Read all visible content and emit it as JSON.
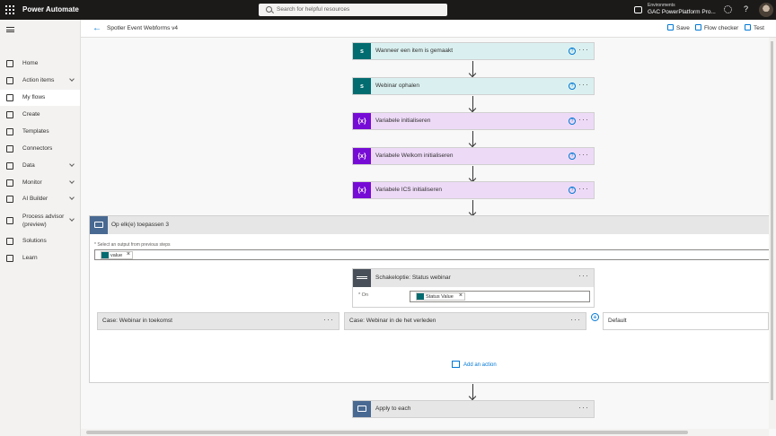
{
  "app": {
    "title": "Power Automate"
  },
  "search": {
    "placeholder": "Search for helpful resources"
  },
  "environment": {
    "label": "Environments",
    "name": "GAC PowerPlatform Pro..."
  },
  "header_icons": [
    "settings-icon",
    "help-icon"
  ],
  "sidebar": {
    "items": [
      {
        "label": "Home",
        "icon": "home-icon"
      },
      {
        "label": "Action items",
        "icon": "clipboard-icon",
        "chevron": true
      },
      {
        "label": "My flows",
        "icon": "flow-icon",
        "active": true
      },
      {
        "label": "Create",
        "icon": "plus-icon"
      },
      {
        "label": "Templates",
        "icon": "templates-icon"
      },
      {
        "label": "Connectors",
        "icon": "connectors-icon"
      },
      {
        "label": "Data",
        "icon": "database-icon",
        "chevron": true
      },
      {
        "label": "Monitor",
        "icon": "monitor-icon",
        "chevron": true
      },
      {
        "label": "AI Builder",
        "icon": "ai-builder-icon",
        "chevron": true
      },
      {
        "label": "Process advisor",
        "label2": "(preview)",
        "icon": "process-advisor-icon",
        "chevron": true
      },
      {
        "label": "Solutions",
        "icon": "solutions-icon"
      },
      {
        "label": "Learn",
        "icon": "book-icon"
      }
    ]
  },
  "command_bar": {
    "flow_title": "Spotler Event Webforms v4",
    "save": "Save",
    "flow_checker": "Flow checker",
    "test": "Test"
  },
  "flow": {
    "steps": [
      {
        "title": "Wanneer een item is gemaakt",
        "type": "sharepoint",
        "icon": "sp"
      },
      {
        "title": "Webinar ophalen",
        "type": "sharepoint",
        "icon": "sp"
      },
      {
        "title": "Variabele initialiseren",
        "type": "variable",
        "icon": "{x}"
      },
      {
        "title": "Variabele Welkom initialiseren",
        "type": "variable",
        "icon": "{x}"
      },
      {
        "title": "Variabele ICS initialiseren",
        "type": "variable",
        "icon": "{x}"
      }
    ],
    "help_glyph": "?",
    "more_glyph": "···",
    "apply_each": {
      "title": "Op elk(e) toepassen 3",
      "select_label": "* Select an output from previous steps",
      "token": "value",
      "switch": {
        "title": "Schakeloptie: Status webinar",
        "on_label": "* On",
        "token": "Status Value"
      },
      "cases": [
        {
          "title": "Case: Webinar in toekomst"
        },
        {
          "title": "Case: Webinar in de het verleden"
        }
      ],
      "default_label": "Default",
      "add_case": "+",
      "add_action": "Add an action"
    },
    "final_step": {
      "title": "Apply to each"
    },
    "token_close": "×"
  }
}
